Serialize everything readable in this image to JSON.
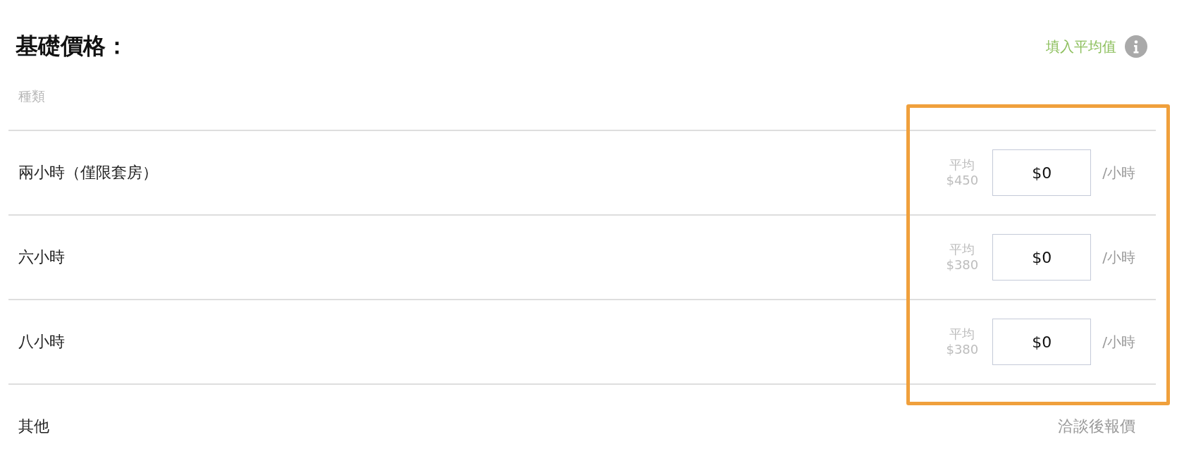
{
  "title": "基礎價格：",
  "fill_average_link": "填入平均值",
  "column_header": "種類",
  "rows": [
    {
      "kind": "price",
      "name": "兩小時（僅限套房）",
      "average_label": "平均",
      "average_value": "$450",
      "value": "$0",
      "unit": "/小時"
    },
    {
      "kind": "price",
      "name": "六小時",
      "average_label": "平均",
      "average_value": "$380",
      "value": "$0",
      "unit": "/小時"
    },
    {
      "kind": "price",
      "name": "八小時",
      "average_label": "平均",
      "average_value": "$380",
      "value": "$0",
      "unit": "/小時"
    },
    {
      "kind": "quote",
      "name": "其他",
      "note": "洽談後報價"
    }
  ]
}
